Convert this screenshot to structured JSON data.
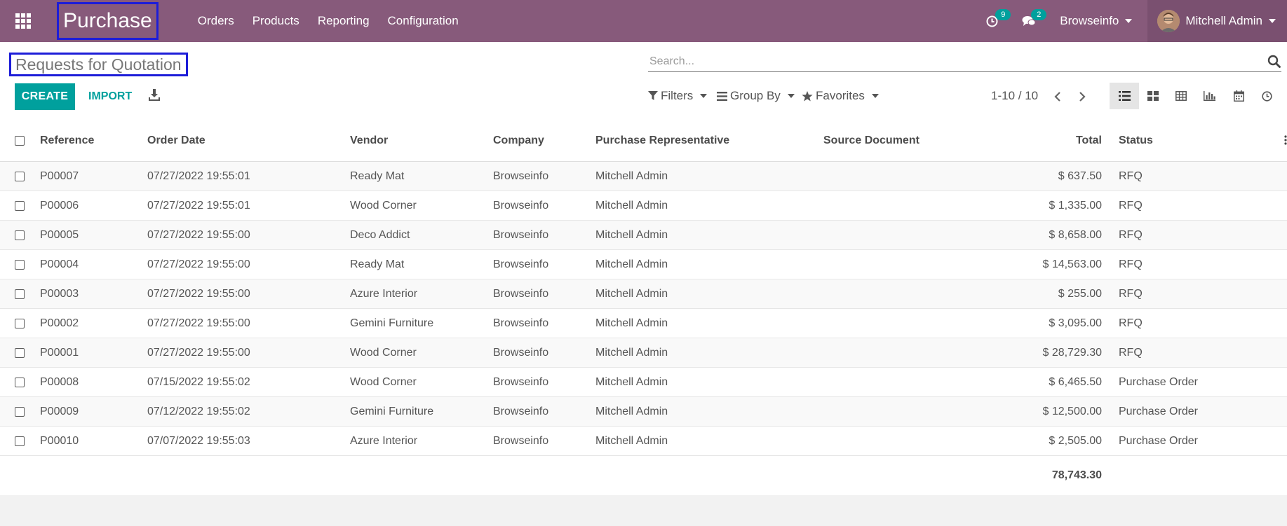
{
  "navbar": {
    "app_name": "Purchase",
    "menu": [
      "Orders",
      "Products",
      "Reporting",
      "Configuration"
    ],
    "activity_count": "9",
    "messages_count": "2",
    "company": "Browseinfo",
    "user": "Mitchell Admin"
  },
  "control_panel": {
    "title": "Requests for Quotation",
    "create_label": "CREATE",
    "import_label": "IMPORT",
    "search_placeholder": "Search...",
    "filters_label": "Filters",
    "groupby_label": "Group By",
    "favorites_label": "Favorites",
    "pager_value": "1-10 / 10"
  },
  "table": {
    "columns": [
      "Reference",
      "Order Date",
      "Vendor",
      "Company",
      "Purchase Representative",
      "Source Document",
      "Total",
      "Status"
    ],
    "rows": [
      [
        "P00007",
        "07/27/2022 19:55:01",
        "Ready Mat",
        "Browseinfo",
        "Mitchell Admin",
        "",
        "$ 637.50",
        "RFQ"
      ],
      [
        "P00006",
        "07/27/2022 19:55:01",
        "Wood Corner",
        "Browseinfo",
        "Mitchell Admin",
        "",
        "$ 1,335.00",
        "RFQ"
      ],
      [
        "P00005",
        "07/27/2022 19:55:00",
        "Deco Addict",
        "Browseinfo",
        "Mitchell Admin",
        "",
        "$ 8,658.00",
        "RFQ"
      ],
      [
        "P00004",
        "07/27/2022 19:55:00",
        "Ready Mat",
        "Browseinfo",
        "Mitchell Admin",
        "",
        "$ 14,563.00",
        "RFQ"
      ],
      [
        "P00003",
        "07/27/2022 19:55:00",
        "Azure Interior",
        "Browseinfo",
        "Mitchell Admin",
        "",
        "$ 255.00",
        "RFQ"
      ],
      [
        "P00002",
        "07/27/2022 19:55:00",
        "Gemini Furniture",
        "Browseinfo",
        "Mitchell Admin",
        "",
        "$ 3,095.00",
        "RFQ"
      ],
      [
        "P00001",
        "07/27/2022 19:55:00",
        "Wood Corner",
        "Browseinfo",
        "Mitchell Admin",
        "",
        "$ 28,729.30",
        "RFQ"
      ],
      [
        "P00008",
        "07/15/2022 19:55:02",
        "Wood Corner",
        "Browseinfo",
        "Mitchell Admin",
        "",
        "$ 6,465.50",
        "Purchase Order"
      ],
      [
        "P00009",
        "07/12/2022 19:55:02",
        "Gemini Furniture",
        "Browseinfo",
        "Mitchell Admin",
        "",
        "$ 12,500.00",
        "Purchase Order"
      ],
      [
        "P00010",
        "07/07/2022 19:55:03",
        "Azure Interior",
        "Browseinfo",
        "Mitchell Admin",
        "",
        "$ 2,505.00",
        "Purchase Order"
      ]
    ],
    "total": "78,743.30"
  },
  "colors": {
    "navbar": "#875a7b",
    "accent": "#00a09d",
    "highlight_box": "#1d1dd8"
  },
  "icons": {
    "apps": "apps-grid-icon",
    "activity": "clock-icon",
    "messages": "chat-bubbles-icon",
    "download": "download-icon",
    "search": "search-icon",
    "filter": "funnel-icon",
    "groupby": "bars-icon",
    "favorites": "star-icon",
    "views": [
      "list-view-icon",
      "kanban-view-icon",
      "pivot-view-icon",
      "graph-view-icon",
      "calendar-view-icon",
      "activity-view-icon"
    ]
  }
}
